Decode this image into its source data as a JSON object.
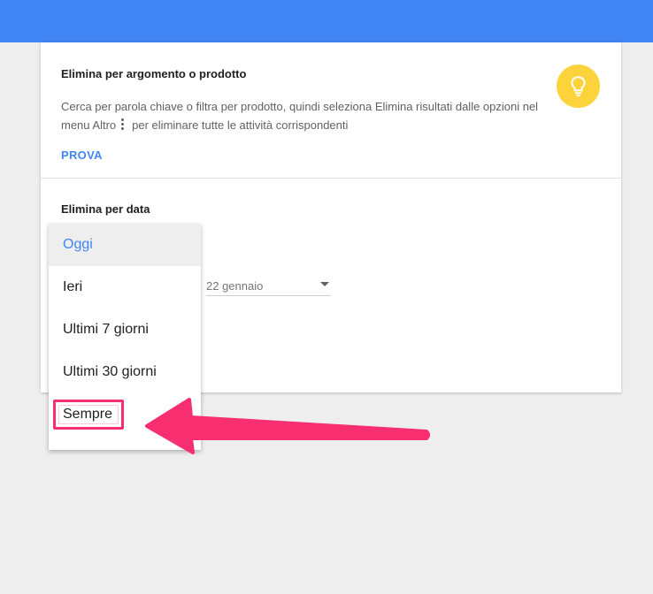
{
  "topic_section": {
    "title": "Elimina per argomento o prodotto",
    "description_before_icon": "Cerca per parola chiave o filtra per prodotto, quindi seleziona Elimina risultati dalle opzioni nel menu Altro",
    "description_after_icon": "per eliminare tutte le attività corrispondenti",
    "try_link": "PROVA",
    "more_icon": "more-vert-icon",
    "tip_icon": "lightbulb-icon"
  },
  "date_section": {
    "title": "Elimina per data",
    "date_value": "22 gennaio"
  },
  "dropdown": {
    "items": [
      {
        "label": "Oggi"
      },
      {
        "label": "Ieri"
      },
      {
        "label": "Ultimi 7 giorni"
      },
      {
        "label": "Ultimi 30 giorni"
      },
      {
        "label": "Sempre"
      }
    ],
    "selected": "Oggi"
  },
  "colors": {
    "top_bar": "#4285f4",
    "link": "#4285f4",
    "tip_circle": "#fdd33b",
    "annotation": "#f72f71"
  }
}
